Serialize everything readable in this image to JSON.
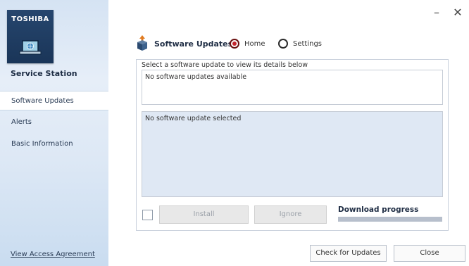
{
  "brand": {
    "logo_text": "TOSHIBA",
    "app_name": "Service Station"
  },
  "sidebar": {
    "items": [
      {
        "label": "Software Updates",
        "active": true
      },
      {
        "label": "Alerts",
        "active": false
      },
      {
        "label": "Basic Information",
        "active": false
      }
    ],
    "footer_link": "View Access Agreement"
  },
  "window": {
    "minimize_glyph": "–",
    "close_glyph": "✕"
  },
  "header": {
    "title": "Software Updates",
    "radios": [
      {
        "label": "Home",
        "selected": true
      },
      {
        "label": "Settings",
        "selected": false
      }
    ]
  },
  "panel": {
    "hint": "Select a software update to view its details below",
    "list_text": "No software updates available",
    "detail_text": "No software update selected"
  },
  "actions": {
    "install_label": "Install",
    "ignore_label": "Ignore",
    "download_label": "Download progress",
    "download_progress": 0
  },
  "footer": {
    "check_label": "Check for Updates",
    "close_label": "Close"
  },
  "colors": {
    "logo_bg": "#1f3d63",
    "radio_selected": "#c5232b",
    "sidebar_bg": "#dce7f4",
    "detail_bg": "#dfe8f4"
  }
}
